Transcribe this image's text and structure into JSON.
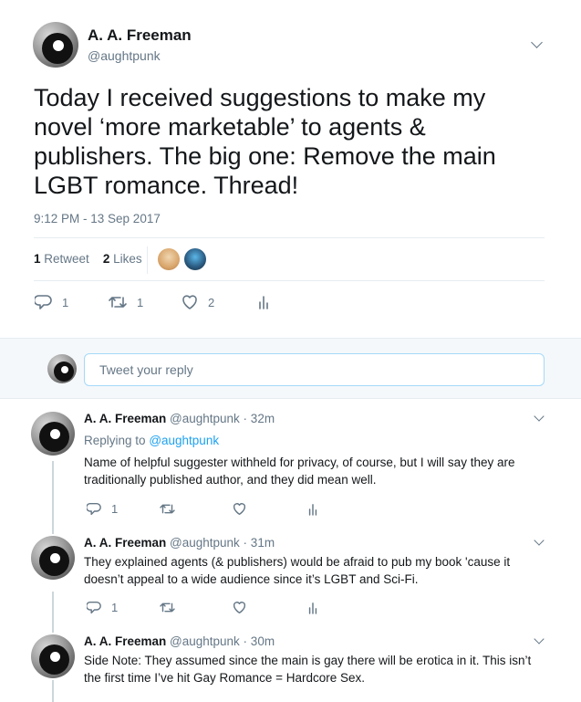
{
  "main_tweet": {
    "author_name": "A. A. Freeman",
    "author_handle": "@aughtpunk",
    "text": "Today I received suggestions to make my novel ‘more marketable’ to agents & publishers. The big one: Remove the main LGBT romance. Thread!",
    "timestamp": "9:12 PM - 13 Sep 2017",
    "retweets_count": "1",
    "retweets_label": "Retweet",
    "likes_count": "2",
    "likes_label": "Likes",
    "actions": {
      "reply_count": "1",
      "retweet_count": "1",
      "like_count": "2"
    }
  },
  "reply_box": {
    "placeholder": "Tweet your reply"
  },
  "replies": [
    {
      "author_name": "A. A. Freeman",
      "author_handle": "@aughtpunk · 32m",
      "replying_label": "Replying to",
      "replying_to": "@aughtpunk",
      "text": "Name of helpful suggester withheld for privacy, of course, but I will say they are traditionally published author, and they did mean well.",
      "reply_count": "1"
    },
    {
      "author_name": "A. A. Freeman",
      "author_handle": "@aughtpunk · 31m",
      "text": "They explained agents (& publishers) would be afraid to pub my book 'cause it doesn’t appeal to a wide audience since it’s LGBT and Sci-Fi.",
      "reply_count": "1"
    },
    {
      "author_name": "A. A. Freeman",
      "author_handle": "@aughtpunk · 30m",
      "text": "Side Note: They assumed since the main is gay there will be erotica in it. This isn’t the first time I’ve hit Gay Romance = Hardcore Sex."
    }
  ],
  "colors": {
    "accent": "#1da1f2",
    "muted": "#657786",
    "text": "#14171a",
    "divider": "#e6ecf0",
    "thread_line": "#ccd6dd"
  }
}
